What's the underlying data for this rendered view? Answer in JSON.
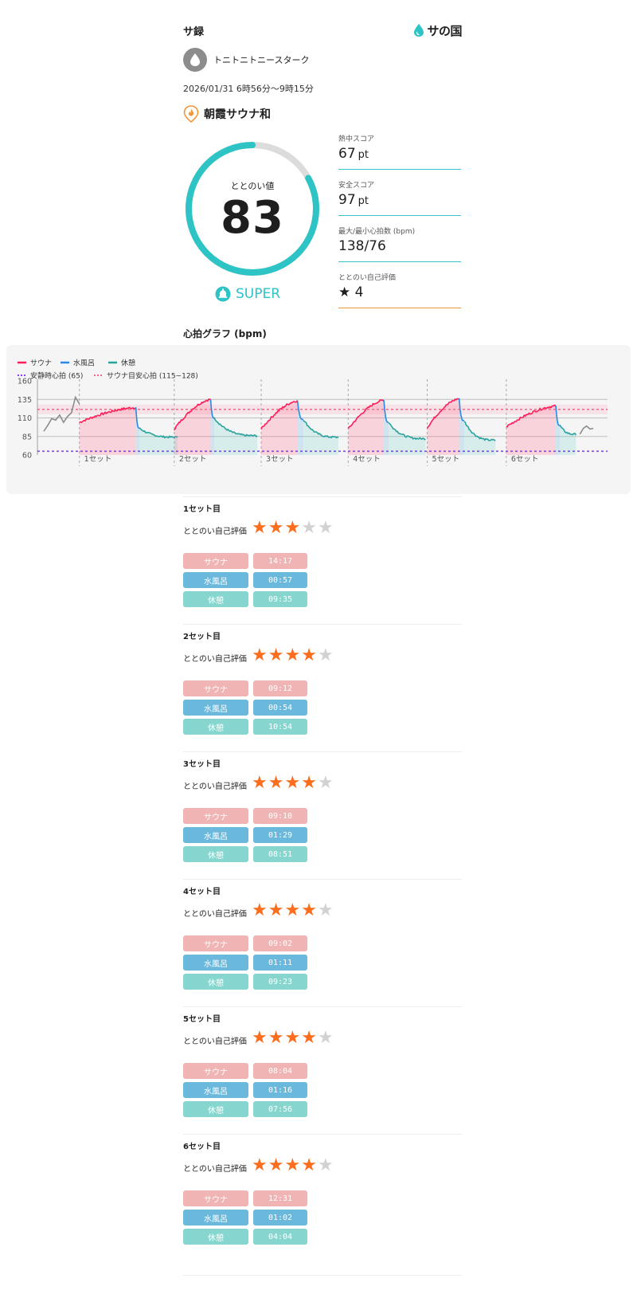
{
  "header": {
    "app_title": "サ録",
    "brand": "サの国"
  },
  "user": {
    "name": "トニトニトニースターク"
  },
  "session": {
    "date_range": "2026/01/31 6時56分〜9時15分",
    "facility": "朝霞サウナ和"
  },
  "score": {
    "label": "ととのい値",
    "value": "83",
    "fraction": 0.83,
    "rank": "SUPER"
  },
  "stats": [
    {
      "label": "熱中スコア",
      "value": "67",
      "unit": "pt"
    },
    {
      "label": "安全スコア",
      "value": "97",
      "unit": "pt"
    },
    {
      "label": "最大/最小心拍数 (bpm)",
      "value": "138/76",
      "unit": ""
    },
    {
      "label": "ととのい自己評価",
      "value": "★ 4",
      "unit": ""
    }
  ],
  "graph_title": "心拍グラフ (bpm)",
  "chart_data": {
    "type": "line",
    "title": "心拍グラフ (bpm)",
    "ylim": [
      60,
      160
    ],
    "yticks": [
      "160",
      "135",
      "110",
      "85",
      "60"
    ],
    "x_unit": "minutes",
    "legend": [
      {
        "label": "サウナ",
        "color": "#ff1e5a"
      },
      {
        "label": "水風呂",
        "color": "#2d87e6"
      },
      {
        "label": "休憩",
        "color": "#2aa39e"
      },
      {
        "label": "安静時心拍 (65)",
        "color": "#8c3cff"
      },
      {
        "label": "サウナ目安心拍 (115~128)",
        "color": "#ff5f8a"
      }
    ],
    "resting_hr": 65,
    "target_band": [
      115,
      128
    ],
    "set_labels": [
      "1セット",
      "2セット",
      "3セット",
      "4セット",
      "5セット",
      "6セット"
    ],
    "set_starts": [
      9,
      33,
      55,
      77,
      97,
      117
    ],
    "idle_points": [
      [
        0,
        92
      ],
      [
        1,
        100
      ],
      [
        2,
        109
      ],
      [
        3,
        107
      ],
      [
        4,
        114
      ],
      [
        5,
        104
      ],
      [
        6,
        112
      ],
      [
        7,
        117
      ],
      [
        8,
        138
      ],
      [
        9,
        129
      ]
    ],
    "sets": [
      {
        "sauna": 14.28,
        "water": 0.95,
        "rest": 9.58,
        "start_hr": 104,
        "peak_hr": 124,
        "water_hr": 96,
        "rest_hr": 85,
        "end_hr": 84
      },
      {
        "sauna": 9.2,
        "water": 0.9,
        "rest": 10.9,
        "start_hr": 95,
        "peak_hr": 135,
        "water_hr": 110,
        "rest_hr": 90,
        "end_hr": 86
      },
      {
        "sauna": 9.17,
        "water": 1.48,
        "rest": 8.85,
        "start_hr": 95,
        "peak_hr": 133,
        "water_hr": 108,
        "rest_hr": 90,
        "end_hr": 84
      },
      {
        "sauna": 9.03,
        "water": 1.18,
        "rest": 9.38,
        "start_hr": 95,
        "peak_hr": 134,
        "water_hr": 104,
        "rest_hr": 90,
        "end_hr": 82
      },
      {
        "sauna": 8.07,
        "water": 1.27,
        "rest": 7.93,
        "start_hr": 97,
        "peak_hr": 136,
        "water_hr": 106,
        "rest_hr": 90,
        "end_hr": 80
      },
      {
        "sauna": 12.52,
        "water": 1.03,
        "rest": 4.07,
        "start_hr": 98,
        "peak_hr": 126,
        "water_hr": 100,
        "rest_hr": 90,
        "end_hr": 88
      }
    ],
    "tail_points": [
      [
        135.6,
        88
      ],
      [
        136.5,
        96
      ],
      [
        137.3,
        99
      ],
      [
        138.2,
        95
      ],
      [
        139,
        96
      ]
    ]
  },
  "sets": [
    {
      "title": "1セット目",
      "rating_label": "ととのい自己評価",
      "rating": 3,
      "sauna_label": "サウナ",
      "sauna_time": "14:17",
      "water_label": "水風呂",
      "water_time": "00:57",
      "rest_label": "休憩",
      "rest_time": "09:35"
    },
    {
      "title": "2セット目",
      "rating_label": "ととのい自己評価",
      "rating": 4,
      "sauna_label": "サウナ",
      "sauna_time": "09:12",
      "water_label": "水風呂",
      "water_time": "00:54",
      "rest_label": "休憩",
      "rest_time": "10:54"
    },
    {
      "title": "3セット目",
      "rating_label": "ととのい自己評価",
      "rating": 4,
      "sauna_label": "サウナ",
      "sauna_time": "09:10",
      "water_label": "水風呂",
      "water_time": "01:29",
      "rest_label": "休憩",
      "rest_time": "08:51"
    },
    {
      "title": "4セット目",
      "rating_label": "ととのい自己評価",
      "rating": 4,
      "sauna_label": "サウナ",
      "sauna_time": "09:02",
      "water_label": "水風呂",
      "water_time": "01:11",
      "rest_label": "休憩",
      "rest_time": "09:23"
    },
    {
      "title": "5セット目",
      "rating_label": "ととのい自己評価",
      "rating": 4,
      "sauna_label": "サウナ",
      "sauna_time": "08:04",
      "water_label": "水風呂",
      "water_time": "01:16",
      "rest_label": "休憩",
      "rest_time": "07:56"
    },
    {
      "title": "6セット目",
      "rating_label": "ととのい自己評価",
      "rating": 4,
      "sauna_label": "サウナ",
      "sauna_time": "12:31",
      "water_label": "水風呂",
      "water_time": "01:02",
      "rest_label": "休憩",
      "rest_time": "04:04"
    }
  ],
  "colors": {
    "accent": "#2ec3c5",
    "orange": "#f2963a",
    "star": "#fa6e1e",
    "sauna_tag": "#f0b4b4",
    "water_tag": "#6ab8dc",
    "rest_tag": "#86d6cf"
  },
  "icons": {
    "brand": "water-drop-icon",
    "avatar": "water-drop-icon",
    "facility": "flame-pin-icon",
    "rank": "bell-icon"
  }
}
